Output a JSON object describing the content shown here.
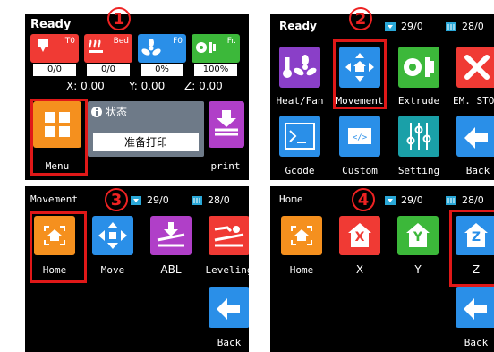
{
  "header_partial": "",
  "colors": {
    "orange": "#f5901e",
    "red": "#f03a34",
    "blue": "#2a8fe8",
    "green": "#3cb83a",
    "purple": "#8a3fc8",
    "teal": "#1aa0a8",
    "brown": "#c08a20",
    "magenta": "#b03fc8",
    "highlight": "#e01818"
  },
  "p1": {
    "badge": "1",
    "title": "Ready",
    "heaters": [
      {
        "icon": "hotend-icon",
        "tag": "T0",
        "value": "0/0"
      },
      {
        "icon": "bed-icon",
        "tag": "Bed",
        "value": "0/0"
      },
      {
        "icon": "fan-icon",
        "tag": "F0",
        "value": "0%"
      },
      {
        "icon": "speed-icon",
        "tag": "Fr.",
        "value": "100%"
      }
    ],
    "x": "X: 0.00",
    "y": "Y: 0.00",
    "z": "Z: 0.00",
    "menu_label": "Menu",
    "status_title": "状态",
    "status_text": "准备打印",
    "print_label": "print"
  },
  "p2": {
    "badge": "2",
    "title": "Ready",
    "temp1": "29/0",
    "temp2": "28/0",
    "items": [
      {
        "icon": "heat-fan-icon",
        "label": "Heat/Fan"
      },
      {
        "icon": "movement-icon",
        "label": "Movement"
      },
      {
        "icon": "extrude-icon",
        "label": "Extrude"
      },
      {
        "icon": "emergency-stop-icon",
        "label": "EM. STOP"
      },
      {
        "icon": "gcode-icon",
        "label": "Gcode"
      },
      {
        "icon": "custom-icon",
        "label": "Custom"
      },
      {
        "icon": "setting-icon",
        "label": "Setting"
      },
      {
        "icon": "back-icon",
        "label": "Back"
      }
    ]
  },
  "p3": {
    "badge": "3",
    "title": "Movement",
    "temp1": "29/0",
    "temp2": "28/0",
    "items": [
      {
        "icon": "home-icon",
        "label": "Home"
      },
      {
        "icon": "move-icon",
        "label": "Move"
      },
      {
        "icon": "abl-icon",
        "label": "ABL"
      },
      {
        "icon": "leveling-icon",
        "label": "Leveling"
      }
    ],
    "back": "Back"
  },
  "p4": {
    "badge": "4",
    "title": "Home",
    "temp1": "29/0",
    "temp2": "28/0",
    "items": [
      {
        "icon": "home-all-icon",
        "label": "Home",
        "letter": ""
      },
      {
        "icon": "home-x-icon",
        "label": "X",
        "letter": "X"
      },
      {
        "icon": "home-y-icon",
        "label": "Y",
        "letter": "Y"
      },
      {
        "icon": "home-z-icon",
        "label": "Z",
        "letter": "Z"
      }
    ],
    "back": "Back"
  }
}
